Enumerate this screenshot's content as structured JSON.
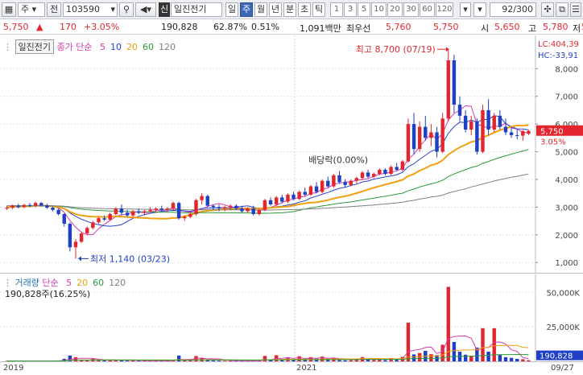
{
  "toolbar": {
    "market": "주",
    "jeon": "전",
    "code": "103590",
    "shin": "신",
    "name": "일진전기",
    "periods": [
      "일",
      "주",
      "월",
      "년",
      "분",
      "초",
      "틱"
    ],
    "active_period": "주",
    "intervals": [
      "1",
      "3",
      "5",
      "10",
      "20",
      "30",
      "60",
      "120"
    ],
    "count": "92/300"
  },
  "quote": {
    "price": "5,750",
    "change_arrow": "▲",
    "change": "170",
    "change_pct": "+3.05%",
    "volume": "190,828",
    "turnover_pct": "62.87%",
    "ratio_pct": "0.51%",
    "amount": "1,091백만",
    "best_quote_label": "최우선",
    "ask": "5,760",
    "bid": "5,750",
    "open_label": "시",
    "open": "5,650",
    "high_label": "고",
    "high": "5,780",
    "low_label": "저",
    "low": "5,"
  },
  "legend": {
    "title": "일진전기",
    "ma_prefix": "종가 단순",
    "ma_periods": [
      "5",
      "10",
      "20",
      "60",
      "120"
    ],
    "ma_colors": [
      "#d63ab0",
      "#2844c8",
      "#f0a010",
      "#2a9a3a",
      "#808080"
    ]
  },
  "right_info": {
    "lc": "LC:404,39",
    "hc": "HC:-33,91"
  },
  "price_axis": [
    "8,000",
    "7,000",
    "6,000",
    "5,000",
    "4,000",
    "3,000",
    "2,000",
    "1,000"
  ],
  "last_price_tag": "5,750",
  "last_pct_tag": "3.05%",
  "annotations": {
    "high": "최고 8,700 (07/19)",
    "low": "최저 1,140 (03/23)",
    "dividend": "배당락(0.00%)"
  },
  "vol_legend": {
    "title": "거래량",
    "ma_prefix": "단순",
    "ma_periods": [
      "5",
      "20",
      "60",
      "120"
    ],
    "ma_colors": [
      "#d63ab0",
      "#f0a010",
      "#2a9a3a",
      "#808080"
    ],
    "value_text": "190,828주(16.25%)"
  },
  "vol_axis": [
    "50,000K",
    "25,000K"
  ],
  "vol_tag": "190,828",
  "vol_pct_tag": "16.25%",
  "x_axis": [
    "2019",
    "2021",
    "09/27"
  ],
  "chart_data": {
    "type": "candlestick",
    "title": "일진전기",
    "ylim": [
      600,
      9200
    ],
    "y_ticks": [
      8000,
      7000,
      6000,
      5000,
      4000,
      3000,
      2000,
      1000
    ],
    "colors": {
      "up": "#e3262d",
      "down": "#1f3fc4"
    },
    "candles": [
      [
        2950,
        3050,
        2900,
        2980
      ],
      [
        2980,
        3100,
        2920,
        3060
      ],
      [
        3060,
        3120,
        2950,
        3000
      ],
      [
        3000,
        3120,
        2960,
        3080
      ],
      [
        3080,
        3150,
        3000,
        3050
      ],
      [
        3050,
        3200,
        3000,
        3150
      ],
      [
        3150,
        3180,
        3020,
        3060
      ],
      [
        3060,
        3120,
        2940,
        2980
      ],
      [
        2980,
        3020,
        2850,
        2900
      ],
      [
        2900,
        2950,
        2700,
        2750
      ],
      [
        2750,
        2780,
        2300,
        2400
      ],
      [
        2400,
        2450,
        1400,
        1550
      ],
      [
        1550,
        1850,
        1140,
        1750
      ],
      [
        1750,
        2100,
        1700,
        2050
      ],
      [
        2050,
        2300,
        2000,
        2250
      ],
      [
        2250,
        2500,
        2200,
        2450
      ],
      [
        2450,
        2650,
        2400,
        2600
      ],
      [
        2600,
        2700,
        2500,
        2550
      ],
      [
        2550,
        2800,
        2500,
        2750
      ],
      [
        2750,
        3000,
        2700,
        2950
      ],
      [
        2950,
        3100,
        2700,
        2800
      ],
      [
        2800,
        2900,
        2650,
        2700
      ],
      [
        2700,
        2900,
        2650,
        2850
      ],
      [
        2850,
        2950,
        2750,
        2800
      ],
      [
        2800,
        2900,
        2700,
        2850
      ],
      [
        2850,
        3000,
        2800,
        2900
      ],
      [
        2900,
        3000,
        2800,
        2950
      ],
      [
        2950,
        3050,
        2850,
        2900
      ],
      [
        2900,
        3000,
        2800,
        2950
      ],
      [
        2950,
        3200,
        2900,
        3150
      ],
      [
        3150,
        3200,
        2550,
        2600
      ],
      [
        2600,
        2700,
        2500,
        2650
      ],
      [
        2650,
        2800,
        2600,
        2750
      ],
      [
        2750,
        3300,
        2700,
        3250
      ],
      [
        3250,
        3500,
        3100,
        3400
      ],
      [
        3400,
        3450,
        3000,
        3050
      ],
      [
        3050,
        3100,
        2900,
        3000
      ],
      [
        3000,
        3100,
        2850,
        2950
      ],
      [
        2950,
        3050,
        2850,
        3000
      ],
      [
        3000,
        3100,
        2900,
        3050
      ],
      [
        3050,
        3100,
        2900,
        2950
      ],
      [
        2950,
        3050,
        2800,
        2850
      ],
      [
        2850,
        3000,
        2800,
        2950
      ],
      [
        2950,
        3050,
        2700,
        2750
      ],
      [
        2750,
        2950,
        2700,
        2900
      ],
      [
        2900,
        3300,
        2850,
        3250
      ],
      [
        3250,
        3350,
        3050,
        3100
      ],
      [
        3100,
        3400,
        3050,
        3350
      ],
      [
        3350,
        3450,
        3150,
        3200
      ],
      [
        3200,
        3500,
        3150,
        3450
      ],
      [
        3450,
        3550,
        3250,
        3300
      ],
      [
        3300,
        3600,
        3250,
        3550
      ],
      [
        3550,
        3700,
        3400,
        3450
      ],
      [
        3450,
        3800,
        3400,
        3750
      ],
      [
        3750,
        3900,
        3500,
        3550
      ],
      [
        3550,
        4000,
        3500,
        3950
      ],
      [
        3950,
        4100,
        3700,
        3750
      ],
      [
        3750,
        4200,
        3700,
        4150
      ],
      [
        4150,
        4300,
        3850,
        3900
      ],
      [
        3900,
        4000,
        3700,
        3800
      ],
      [
        3800,
        4000,
        3750,
        3950
      ],
      [
        3950,
        4100,
        3850,
        4050
      ],
      [
        4050,
        4300,
        4000,
        4250
      ],
      [
        4250,
        4350,
        4050,
        4100
      ],
      [
        4100,
        4250,
        4050,
        4200
      ],
      [
        4200,
        4400,
        4150,
        4350
      ],
      [
        4350,
        4400,
        4150,
        4200
      ],
      [
        4200,
        4500,
        4150,
        4450
      ],
      [
        4450,
        4600,
        4300,
        4350
      ],
      [
        4350,
        4700,
        4300,
        4650
      ],
      [
        4650,
        6200,
        4600,
        6000
      ],
      [
        6000,
        6400,
        4900,
        5100
      ],
      [
        5100,
        6100,
        5000,
        5900
      ],
      [
        5900,
        6300,
        5400,
        5500
      ],
      [
        5500,
        6000,
        5200,
        5700
      ],
      [
        5700,
        5900,
        4800,
        5000
      ],
      [
        5000,
        6400,
        4950,
        6200
      ],
      [
        6200,
        8700,
        6100,
        8300
      ],
      [
        8300,
        8500,
        6400,
        6700
      ],
      [
        6700,
        7000,
        6100,
        6300
      ],
      [
        6300,
        6500,
        5700,
        5800
      ],
      [
        5800,
        6300,
        5600,
        6100
      ],
      [
        6100,
        6200,
        4900,
        5000
      ],
      [
        5000,
        6700,
        4950,
        6500
      ],
      [
        6500,
        6900,
        5600,
        5800
      ],
      [
        5800,
        6400,
        5700,
        6300
      ],
      [
        6300,
        6500,
        5800,
        5900
      ],
      [
        5900,
        6200,
        5600,
        5700
      ],
      [
        5700,
        5900,
        5500,
        5600
      ],
      [
        5600,
        5800,
        5450,
        5580
      ],
      [
        5580,
        5780,
        5400,
        5750
      ],
      [
        5650,
        5780,
        5600,
        5750
      ]
    ],
    "volume_ylim": [
      0,
      56000
    ],
    "volume": [
      300,
      250,
      200,
      220,
      250,
      300,
      200,
      180,
      220,
      600,
      1800,
      4200,
      3000,
      1200,
      900,
      1800,
      700,
      600,
      1300,
      900,
      700,
      500,
      600,
      400,
      350,
      500,
      400,
      350,
      300,
      900,
      4200,
      600,
      700,
      3800,
      2600,
      1100,
      700,
      500,
      400,
      350,
      300,
      350,
      300,
      450,
      400,
      3900,
      900,
      4400,
      1400,
      2800,
      900,
      3700,
      1300,
      3000,
      1900,
      3400,
      1100,
      2700,
      900,
      700,
      800,
      1500,
      3100,
      1200,
      1000,
      1900,
      900,
      2300,
      1100,
      3200,
      28000,
      5000,
      6000,
      7600,
      5200,
      4500,
      12000,
      54000,
      14000,
      7000,
      4800,
      4000,
      10000,
      24000,
      7000,
      24000,
      5000,
      3000,
      2500,
      1800,
      1500,
      800
    ]
  }
}
